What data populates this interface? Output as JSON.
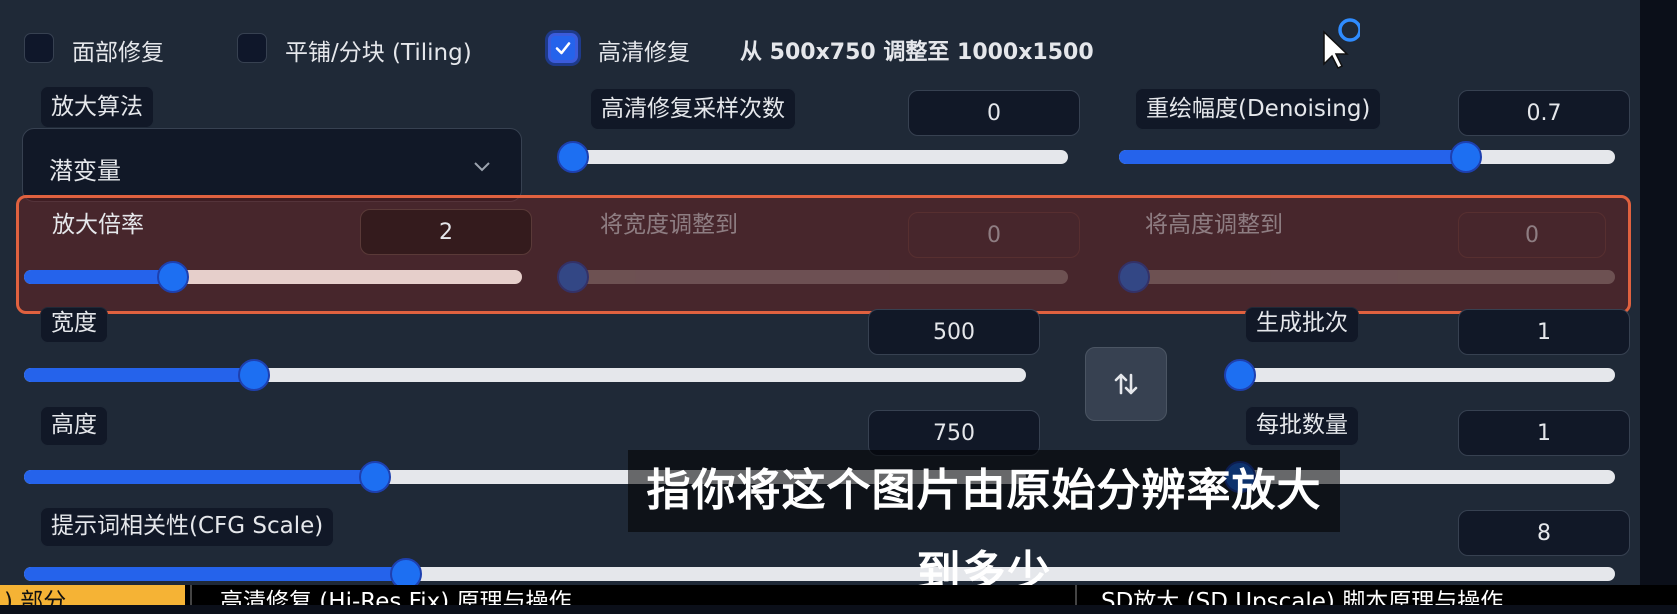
{
  "checkboxes": {
    "face_restore": {
      "label": "面部修复",
      "checked": false
    },
    "tiling": {
      "label": "平铺/分块 (Tiling)",
      "checked": false
    },
    "hires_fix": {
      "label": "高清修复",
      "checked": true
    }
  },
  "hires_note": "从 500x750 调整至 1000x1500",
  "upscaler": {
    "label": "放大算法",
    "value": "潜变量"
  },
  "hires_steps": {
    "label": "高清修复采样次数",
    "value": "0",
    "fraction": 0.0
  },
  "denoising": {
    "label": "重绘幅度(Denoising)",
    "value": "0.7",
    "fraction": 0.7
  },
  "upscale_by": {
    "label": "放大倍率",
    "value": "2",
    "fraction": 0.3
  },
  "resize_width_to": {
    "label": "将宽度调整到",
    "value": "0",
    "fraction": 0.0
  },
  "resize_height_to": {
    "label": "将高度调整到",
    "value": "0",
    "fraction": 0.0
  },
  "width": {
    "label": "宽度",
    "value": "500",
    "fraction": 0.23
  },
  "height": {
    "label": "高度",
    "value": "750",
    "fraction": 0.35
  },
  "batch_count": {
    "label": "生成批次",
    "value": "1",
    "fraction": 0.0
  },
  "batch_size": {
    "label": "每批数量",
    "value": "1",
    "fraction": 0.0
  },
  "cfg_scale": {
    "label": "提示词相关性(CFG Scale)",
    "value": "8",
    "fraction": 0.24
  },
  "subtitle": "指你将这个图片由原始分辨率放大到多少",
  "chapters": [
    ") 部分",
    "高清修复 (Hi-Res Fix) 原理与操作",
    "SD放大 (SD Upscale) 脚本原理与操作"
  ],
  "colors": {
    "accent": "#2563eb",
    "highlight_border": "#e0613f",
    "chapter_active": "#f5b335"
  },
  "icons": {
    "check": "check-icon",
    "chevron": "chevron-down-icon",
    "swap": "swap-arrows-icon",
    "cursor": "mouse-cursor-icon"
  }
}
